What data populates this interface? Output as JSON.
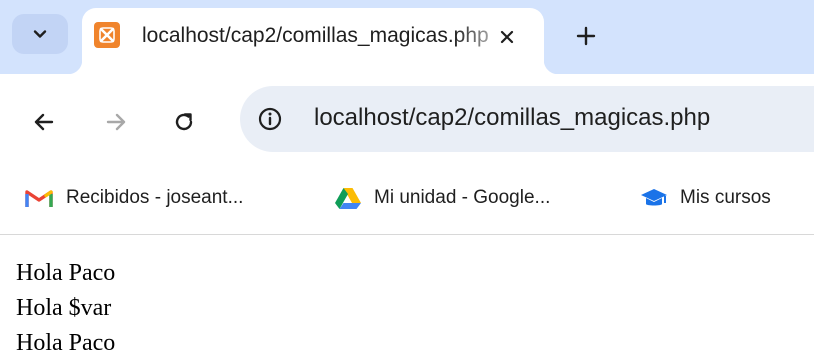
{
  "tab": {
    "title": "localhost/cap2/comillas_magicas.php",
    "favicon": "xampp-icon"
  },
  "toolbar": {
    "url": "localhost/cap2/comillas_magicas.php"
  },
  "bookmarks": [
    {
      "label": "Recibidos - joseant...",
      "icon": "gmail-icon"
    },
    {
      "label": "Mi unidad - Google...",
      "icon": "google-drive-icon"
    },
    {
      "label": "Mis cursos",
      "icon": "graduation-cap-icon"
    }
  ],
  "page": {
    "lines": [
      "Hola Paco",
      "Hola $var",
      "Hola Paco"
    ]
  },
  "colors": {
    "tabstrip": "#d3e3fd",
    "omnibox": "#e9eef6",
    "favicon": "#f0842c"
  }
}
